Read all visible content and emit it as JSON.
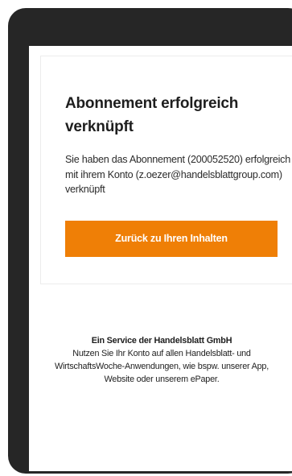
{
  "confirmation": {
    "title": "Abonnement erfolgreich verknüpft",
    "message": "Sie haben das Abonnement (200052520) erfolgreich mit ihrem Konto (z.oezer@handelsblattgroup.com) verknüpft",
    "back_button_label": "Zurück zu Ihren Inhalten"
  },
  "footer": {
    "title": "Ein Service der Handelsblatt GmbH",
    "text": "Nutzen Sie Ihr Konto auf allen Handelsblatt- und WirtschaftsWoche-Anwendungen, wie bspw. unserer App, Website oder unserem ePaper."
  },
  "colors": {
    "accent": "#ef7f06",
    "device_frame": "#262626",
    "text": "#1e1e1e"
  }
}
